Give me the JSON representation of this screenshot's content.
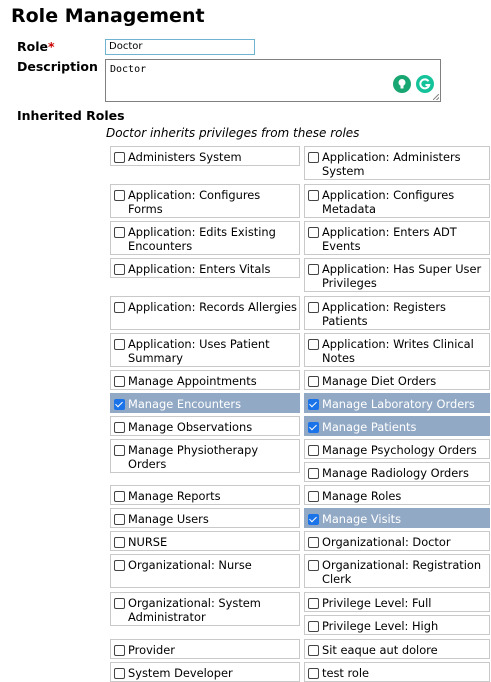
{
  "page": {
    "title": "Role Management"
  },
  "form": {
    "role_label": "Role",
    "required_mark": "*",
    "role_value": "Doctor",
    "description_label": "Description",
    "description_value": "Doctor"
  },
  "inherited": {
    "heading": "Inherited Roles",
    "subtitle": "Doctor inherits privileges from these roles",
    "left": [
      {
        "label": "Administers System",
        "checked": false
      },
      {
        "label": "Application: Configures Forms",
        "checked": false
      },
      {
        "label": "Application: Edits Existing Encounters",
        "checked": false
      },
      {
        "label": "Application: Enters Vitals",
        "checked": false
      },
      {
        "label": "Application: Records Allergies",
        "checked": false
      },
      {
        "label": "Application: Uses Patient Summary",
        "checked": false
      },
      {
        "label": "Manage Appointments",
        "checked": false
      },
      {
        "label": "Manage Encounters",
        "checked": true
      },
      {
        "label": "Manage Observations",
        "checked": false
      },
      {
        "label": "Manage Physiotherapy Orders",
        "checked": false
      },
      {
        "label": "Manage Reports",
        "checked": false
      },
      {
        "label": "Manage Users",
        "checked": false
      },
      {
        "label": "NURSE",
        "checked": false
      },
      {
        "label": "Organizational: Nurse",
        "checked": false
      },
      {
        "label": "Organizational: System Administrator",
        "checked": false
      },
      {
        "label": "Provider",
        "checked": false
      },
      {
        "label": "System Developer",
        "checked": false
      }
    ],
    "right": [
      {
        "label": "Application: Administers System",
        "checked": false
      },
      {
        "label": "Application: Configures Metadata",
        "checked": false
      },
      {
        "label": "Application: Enters ADT Events",
        "checked": false
      },
      {
        "label": "Application: Has Super User Privileges",
        "checked": false
      },
      {
        "label": "Application: Registers Patients",
        "checked": false
      },
      {
        "label": "Application: Writes Clinical Notes",
        "checked": false
      },
      {
        "label": "Manage Diet Orders",
        "checked": false
      },
      {
        "label": "Manage Laboratory Orders",
        "checked": true
      },
      {
        "label": "Manage Patients",
        "checked": true
      },
      {
        "label": "Manage Psychology Orders",
        "checked": false
      },
      {
        "label": "Manage Radiology Orders",
        "checked": false
      },
      {
        "label": "Manage Roles",
        "checked": false
      },
      {
        "label": "Manage Visits",
        "checked": true
      },
      {
        "label": "Organizational: Doctor",
        "checked": false
      },
      {
        "label": "Organizational: Registration Clerk",
        "checked": false
      },
      {
        "label": "Privilege Level: Full",
        "checked": false
      },
      {
        "label": "Privilege Level: High",
        "checked": false
      },
      {
        "label": "Sit eaque aut dolore",
        "checked": false
      },
      {
        "label": "test role",
        "checked": false
      }
    ]
  },
  "colors": {
    "checked_bg": "#92a9c5",
    "checkbox_accent": "#1a73e8",
    "required": "#cc0000"
  },
  "icons": {
    "grammar_bulb": "lightbulb-icon",
    "grammarly": "grammarly-icon"
  }
}
